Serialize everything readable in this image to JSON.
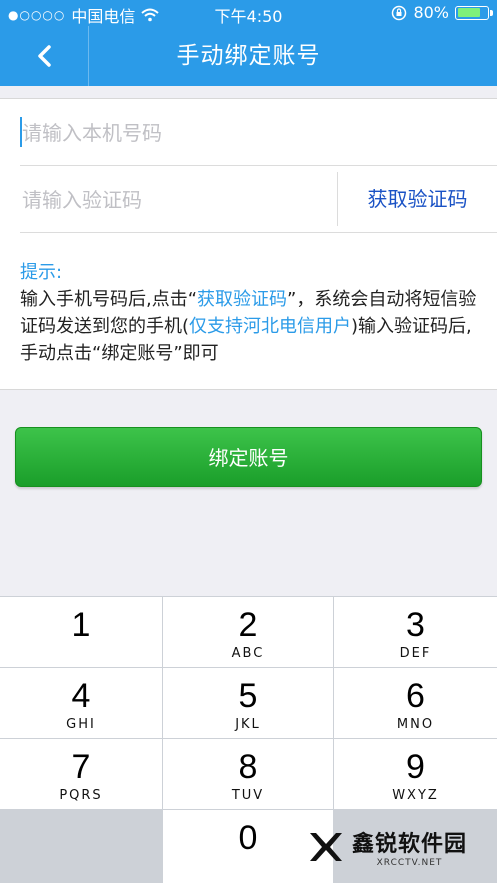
{
  "status_bar": {
    "carrier_dots": "●○○○○",
    "carrier": "中国电信",
    "time": "下午4:50",
    "battery": "80%",
    "battery_level": 0.8
  },
  "nav": {
    "back_icon": "chevron-left",
    "title": "手动绑定账号"
  },
  "form": {
    "phone_placeholder": "请输入本机号码",
    "code_placeholder": "请输入验证码",
    "get_code_label": "获取验证码"
  },
  "tip": {
    "label": "提示:",
    "part1": " 输入手机号码后,点击“",
    "link1": "获取验证码",
    "part2": "”，系统会自动将短信验证码发送到您的手机(",
    "link2": "仅支持河北电信用户",
    "part3": ")输入验证码后,手动点击“绑定账号”即可"
  },
  "bind_button": "绑定账号",
  "keypad": {
    "keys": [
      {
        "num": "1",
        "letters": ""
      },
      {
        "num": "2",
        "letters": "ABC"
      },
      {
        "num": "3",
        "letters": "DEF"
      },
      {
        "num": "4",
        "letters": "GHI"
      },
      {
        "num": "5",
        "letters": "JKL"
      },
      {
        "num": "6",
        "letters": "MNO"
      },
      {
        "num": "7",
        "letters": "PQRS"
      },
      {
        "num": "8",
        "letters": "TUV"
      },
      {
        "num": "9",
        "letters": "WXYZ"
      },
      {
        "num": "0",
        "letters": ""
      }
    ]
  },
  "watermark": {
    "main": "鑫锐软件园",
    "sub": "XRCCTV.NET"
  },
  "colors": {
    "accent": "#2b9be8",
    "link_dark": "#1a52c5",
    "button_green": "#24b236"
  }
}
